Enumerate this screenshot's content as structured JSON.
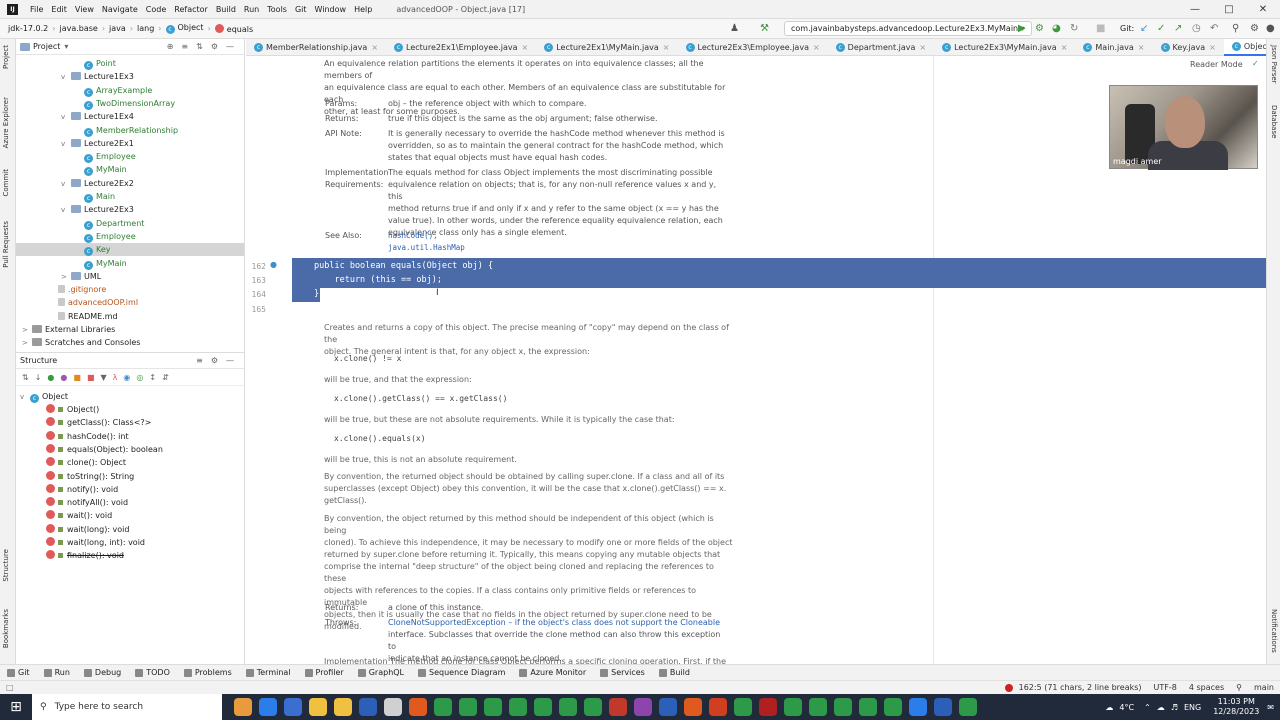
{
  "menubar": {
    "items": [
      "File",
      "Edit",
      "View",
      "Navigate",
      "Code",
      "Refactor",
      "Build",
      "Run",
      "Tools",
      "Git",
      "Window",
      "Help"
    ],
    "title": "advancedOOP - Object.java [17]"
  },
  "navbar": {
    "crumbs": [
      "jdk-17.0.2",
      "java.base",
      "java",
      "lang",
      "Object",
      "equals"
    ],
    "run_config": "com.javainbabysteps.advancedoop.Lecture2Ex3.MyMain",
    "git_label": "Git:"
  },
  "left_strip": [
    "Project",
    "Azure Explorer",
    "Commit",
    "Pull Requests",
    "Structure",
    "Bookmarks"
  ],
  "right_strip": [
    "Json Parser",
    "Database",
    "Notifications"
  ],
  "project_panel": {
    "title": "Project",
    "items": [
      {
        "label": "Point",
        "kind": "class",
        "indent": 4
      },
      {
        "label": "Lecture1Ex3",
        "kind": "folder",
        "indent": 3,
        "arrow": "v"
      },
      {
        "label": "ArrayExample",
        "kind": "class",
        "indent": 4
      },
      {
        "label": "TwoDimensionArray",
        "kind": "class",
        "indent": 4
      },
      {
        "label": "Lecture1Ex4",
        "kind": "folder",
        "indent": 3,
        "arrow": "v"
      },
      {
        "label": "MemberRelationship",
        "kind": "class",
        "indent": 4
      },
      {
        "label": "Lecture2Ex1",
        "kind": "folder",
        "indent": 3,
        "arrow": "v"
      },
      {
        "label": "Employee",
        "kind": "class",
        "indent": 4
      },
      {
        "label": "MyMain",
        "kind": "class",
        "indent": 4
      },
      {
        "label": "Lecture2Ex2",
        "kind": "folder",
        "indent": 3,
        "arrow": "v"
      },
      {
        "label": "Main",
        "kind": "class",
        "indent": 4
      },
      {
        "label": "Lecture2Ex3",
        "kind": "folder",
        "indent": 3,
        "arrow": "v"
      },
      {
        "label": "Department",
        "kind": "class",
        "indent": 4
      },
      {
        "label": "Employee",
        "kind": "class",
        "indent": 4
      },
      {
        "label": "Key",
        "kind": "class",
        "indent": 4,
        "selected": true
      },
      {
        "label": "MyMain",
        "kind": "class",
        "indent": 4
      },
      {
        "label": "UML",
        "kind": "folder",
        "indent": 3,
        "arrow": ">"
      },
      {
        "label": ".gitignore",
        "kind": "file",
        "indent": 2,
        "color": "orange"
      },
      {
        "label": "advancedOOP.iml",
        "kind": "file",
        "indent": 2,
        "color": "orange"
      },
      {
        "label": "README.md",
        "kind": "file",
        "indent": 2
      },
      {
        "label": "External Libraries",
        "kind": "lib",
        "indent": 0,
        "arrow": ">"
      },
      {
        "label": "Scratches and Consoles",
        "kind": "lib",
        "indent": 0,
        "arrow": ">"
      }
    ]
  },
  "structure_panel": {
    "title": "Structure",
    "root": "Object",
    "members": [
      "Object()",
      "getClass(): Class<?>",
      "hashCode(): int",
      "equals(Object): boolean",
      "clone(): Object",
      "toString(): String",
      "notify(): void",
      "notifyAll(): void",
      "wait(): void",
      "wait(long): void",
      "wait(long, int): void",
      "finalize(): void"
    ]
  },
  "tabs": [
    {
      "label": "MemberRelationship.java"
    },
    {
      "label": "Lecture2Ex1\\Employee.java"
    },
    {
      "label": "Lecture2Ex1\\MyMain.java"
    },
    {
      "label": "Lecture2Ex3\\Employee.java"
    },
    {
      "label": "Department.java"
    },
    {
      "label": "Lecture2Ex3\\MyMain.java"
    },
    {
      "label": "Main.java"
    },
    {
      "label": "Key.java"
    },
    {
      "label": "Object.java",
      "active": true
    }
  ],
  "editor": {
    "reader_mode": "Reader Mode",
    "doc_top": {
      "intro": [
        "An equivalence relation partitions the elements it operates on into equivalence classes; all the members of",
        "an equivalence class are equal to each other. Members of an equivalence class are substitutable for each",
        "other, at least for some purposes."
      ],
      "params_key": "Params:",
      "params_val": "obj – the reference object with which to compare.",
      "returns_key": "Returns:",
      "returns_val": "true if this object is the same as the obj argument; false otherwise.",
      "apinote_key": "API Note:",
      "apinote_val": [
        "It is generally necessary to override the hashCode method whenever this method is",
        "overridden, so as to maintain the general contract for the hashCode method, which",
        "states that equal objects must have equal hash codes."
      ],
      "impl_key": [
        "Implementation",
        "Requirements:"
      ],
      "impl_val": [
        "The equals method for class Object implements the most discriminating possible",
        "equivalence relation on objects; that is, for any non-null reference values x and y, this",
        "method returns true if and only if x and y refer to the same object (x == y has the",
        "value true). In other words, under the reference equality equivalence relation, each",
        "equivalence class only has a single element."
      ],
      "seealso_key": "See Also:",
      "seealso_val": [
        "hashCode(),",
        "java.util.HashMap"
      ]
    },
    "code": {
      "line_numbers": [
        "162",
        "163",
        "164",
        "165"
      ],
      "lines": [
        "public boolean equals(Object obj) {",
        "    return (this == obj);",
        "}"
      ]
    },
    "doc_bottom": {
      "p1": [
        "Creates and returns a copy of this object. The precise meaning of \"copy\" may depend on the class of the",
        "object. The general intent is that, for any object x, the expression:"
      ],
      "c1": "x.clone() != x",
      "p2": "will be true, and that the expression:",
      "c2": "x.clone().getClass() == x.getClass()",
      "p3": "will be  true, but these are not absolute requirements. While it is typically the case that:",
      "c3": "x.clone().equals(x)",
      "p4": "will be  true, this is not an absolute requirement.",
      "p5": [
        "By convention, the returned object should be obtained by calling super.clone. If a class and all of its",
        "superclasses (except Object) obey this convention, it will be the case that x.clone().getClass() == x.",
        "getClass()."
      ],
      "p6": [
        "By convention, the object returned by this method should be independent of this object (which is being",
        "cloned). To achieve this independence, it may be necessary to modify one or more fields of the object",
        "returned by  super.clone before returning it. Typically, this means copying any mutable objects that",
        "comprise the internal \"deep structure\" of the object being cloned and replacing the references to these",
        "objects with references to the copies. If a class contains only primitive fields or references to immutable",
        "objects, then it is usually the case that no fields in the object returned by  super.clone need to be",
        "modified."
      ],
      "returns_key": "Returns:",
      "returns_val": "a clone of this instance.",
      "throws_key": "Throws:",
      "throws_val": [
        "CloneNotSupportedException – if the object's class does not support the Cloneable",
        "interface. Subclasses that override the clone method can also throw this exception to",
        "indicate that an instance cannot be cloned."
      ],
      "impl_partial": "Implementation  The method clone for class Object performs a specific cloning operation. First, if the"
    }
  },
  "webcam": {
    "name": "magdi amer"
  },
  "toolwindows": [
    "Git",
    "Run",
    "Debug",
    "TODO",
    "Problems",
    "Terminal",
    "Profiler",
    "GraphQL",
    "Sequence Diagram",
    "Azure Monitor",
    "Services",
    "Build"
  ],
  "statusbar": {
    "position": "162:5 (71 chars, 2 line breaks)",
    "encoding": "UTF-8",
    "indent": "4 spaces",
    "branch": "main"
  },
  "taskbar": {
    "search_placeholder": "Type here to search",
    "weather": "4°C",
    "lang": "ENG",
    "time": "11:03 PM",
    "date": "12/28/2023"
  }
}
